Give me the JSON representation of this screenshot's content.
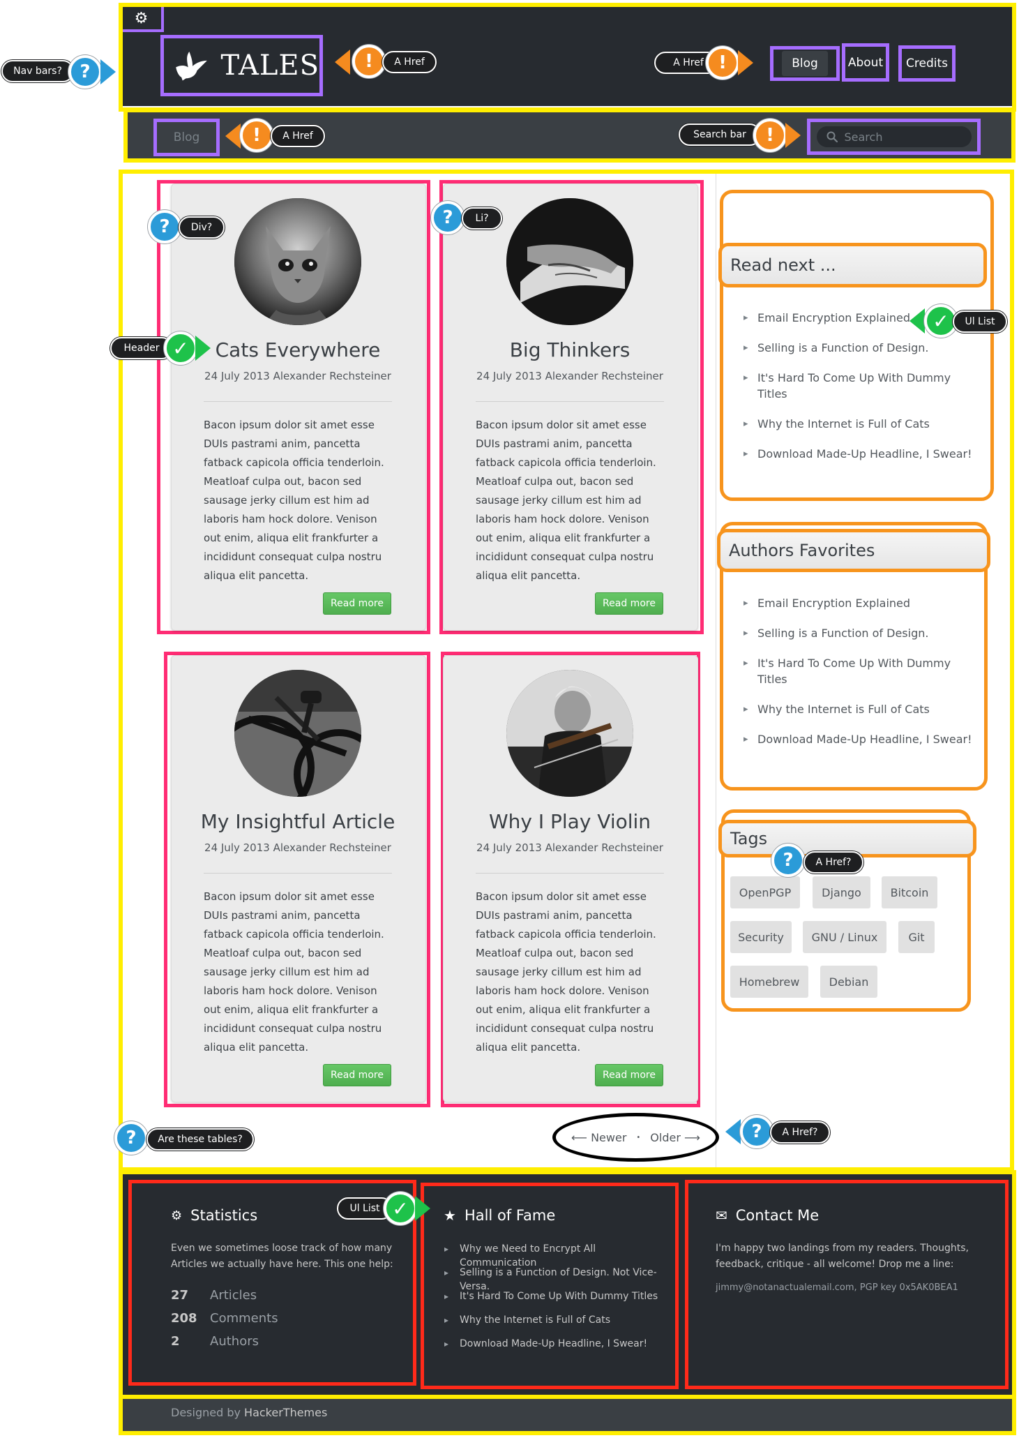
{
  "brand": {
    "name": "TALES"
  },
  "nav": {
    "items": [
      {
        "label": "Blog"
      },
      {
        "label": "About"
      },
      {
        "label": "Credits"
      }
    ]
  },
  "subnav": {
    "active": "Blog",
    "search_placeholder": "Search"
  },
  "posts": [
    {
      "title": "Cats Everywhere",
      "meta": "24 July 2013 Alexander Rechsteiner",
      "body": "Bacon ipsum dolor sit amet esse DUIs pastrami anim, pancetta fatback capicola officia tenderloin. Meatloaf culpa out, bacon sed sausage jerky cillum est him ad laboris ham hock dolore. Venison out enim, aliqua elit frankfurter a incididunt consequat culpa nostru aliqua elit pancetta.",
      "button": "Read more",
      "image": "kitten"
    },
    {
      "title": "Big Thinkers",
      "meta": "24 July 2013 Alexander Rechsteiner",
      "body": "Bacon ipsum dolor sit amet esse DUIs pastrami anim, pancetta fatback capicola officia tenderloin. Meatloaf culpa out, bacon sed sausage jerky cillum est him ad laboris ham hock dolore. Venison out enim, aliqua elit frankfurter a incididunt consequat culpa nostru aliqua elit pancetta.",
      "button": "Read more",
      "image": "hands"
    },
    {
      "title": "My Insightful Article",
      "meta": "24 July 2013 Alexander Rechsteiner",
      "body": "Bacon ipsum dolor sit amet esse DUIs pastrami anim, pancetta fatback capicola officia tenderloin. Meatloaf culpa out, bacon sed sausage jerky cillum est him ad laboris ham hock dolore. Venison out enim, aliqua elit frankfurter a incididunt consequat culpa nostru aliqua elit pancetta.",
      "button": "Read more",
      "image": "bicycle"
    },
    {
      "title": "Why I Play Violin",
      "meta": "24 July 2013 Alexander Rechsteiner",
      "body": "Bacon ipsum dolor sit amet esse DUIs pastrami anim, pancetta fatback capicola officia tenderloin. Meatloaf culpa out, bacon sed sausage jerky cillum est him ad laboris ham hock dolore. Venison out enim, aliqua elit frankfurter a incididunt consequat culpa nostru aliqua elit pancetta.",
      "button": "Read more",
      "image": "violinist"
    }
  ],
  "sidebar": {
    "read_next": {
      "title": "Read next ...",
      "items": [
        "Email Encryption Explained",
        "Selling is a Function of Design.",
        "It's Hard To Come Up With Dummy Titles",
        "Why the Internet is Full of Cats",
        "Download Made-Up Headline, I Swear!"
      ]
    },
    "favorites": {
      "title": "Authors Favorites",
      "items": [
        "Email Encryption Explained",
        "Selling is a Function of Design.",
        "It's Hard To Come Up With Dummy Titles",
        "Why the Internet is Full of Cats",
        "Download Made-Up Headline, I Swear!"
      ]
    },
    "tags": {
      "title": "Tags",
      "items": [
        "OpenPGP",
        "Django",
        "Bitcoin",
        "Security",
        "GNU / Linux",
        "Git",
        "Homebrew",
        "Debian"
      ]
    }
  },
  "pager": {
    "newer": "⟵ Newer",
    "sep": "•",
    "older": "Older ⟶"
  },
  "footer": {
    "stats": {
      "title": "Statistics",
      "text": "Even we sometimes loose track of how many Articles we actually have here. This one help:",
      "rows": [
        {
          "value": "27",
          "label": "Articles"
        },
        {
          "value": "208",
          "label": "Comments"
        },
        {
          "value": "2",
          "label": "Authors"
        }
      ]
    },
    "fame": {
      "title": "Hall of Fame",
      "items": [
        "Why we Need to Encrypt All Communication",
        "Selling is a Function of Design. Not Vice-Versa.",
        "It's Hard To Come Up With Dummy Titles",
        "Why the Internet is Full of Cats",
        "Download Made-Up Headline, I Swear!"
      ]
    },
    "contact": {
      "title": "Contact Me",
      "text": "I'm happy two landings from my readers. Thoughts, feedback, critique - all welcome! Drop me a line:",
      "email": "jimmy@notanactualemail.com, PGP key 0x5AK0BEA1"
    },
    "credit_prefix": "Designed by ",
    "credit_link": "HackerThemes"
  },
  "annotations": {
    "nav_bars": "Nav bars?",
    "a_href": "A Href",
    "search_bar": "Search bar",
    "div": "Div?",
    "li": "Li?",
    "header": "Header",
    "ul_list": "Ul List",
    "a_href_q": "A Href?",
    "tables": "Are these tables?",
    "colors": {
      "question": "#2b9bd8",
      "warning": "#f58b1f",
      "ok": "#1ec24a",
      "frame_yellow": "#ffee00",
      "frame_purple": "#a66dff",
      "frame_pink": "#ff2c74",
      "frame_orange": "#f7941d",
      "frame_red": "#ff2a1a"
    }
  }
}
